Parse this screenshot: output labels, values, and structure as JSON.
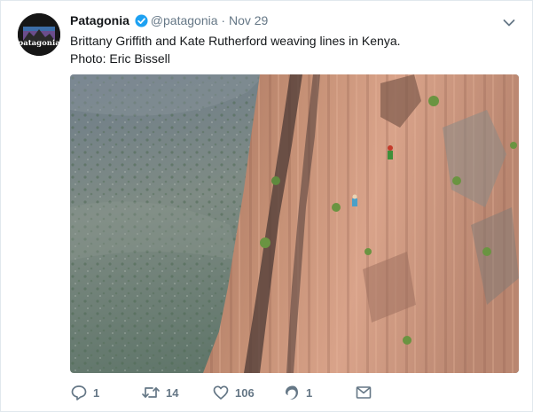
{
  "tweet": {
    "author_name": "Patagonia",
    "author_handle": "@patagonia",
    "separator": "·",
    "date": "Nov 29",
    "text_line1": "Brittany Griffith and Kate Rutherford weaving lines in Kenya.",
    "text_line2": "Photo: Eric Bissell",
    "avatar_logo_text": "patagonia",
    "verified_icon": "verified-badge-icon",
    "menu_icon": "chevron-down-icon",
    "accent_color": "#1da1f2"
  },
  "actions": {
    "reply_count": "1",
    "retweet_count": "14",
    "like_count": "106",
    "moments_count": "1"
  }
}
